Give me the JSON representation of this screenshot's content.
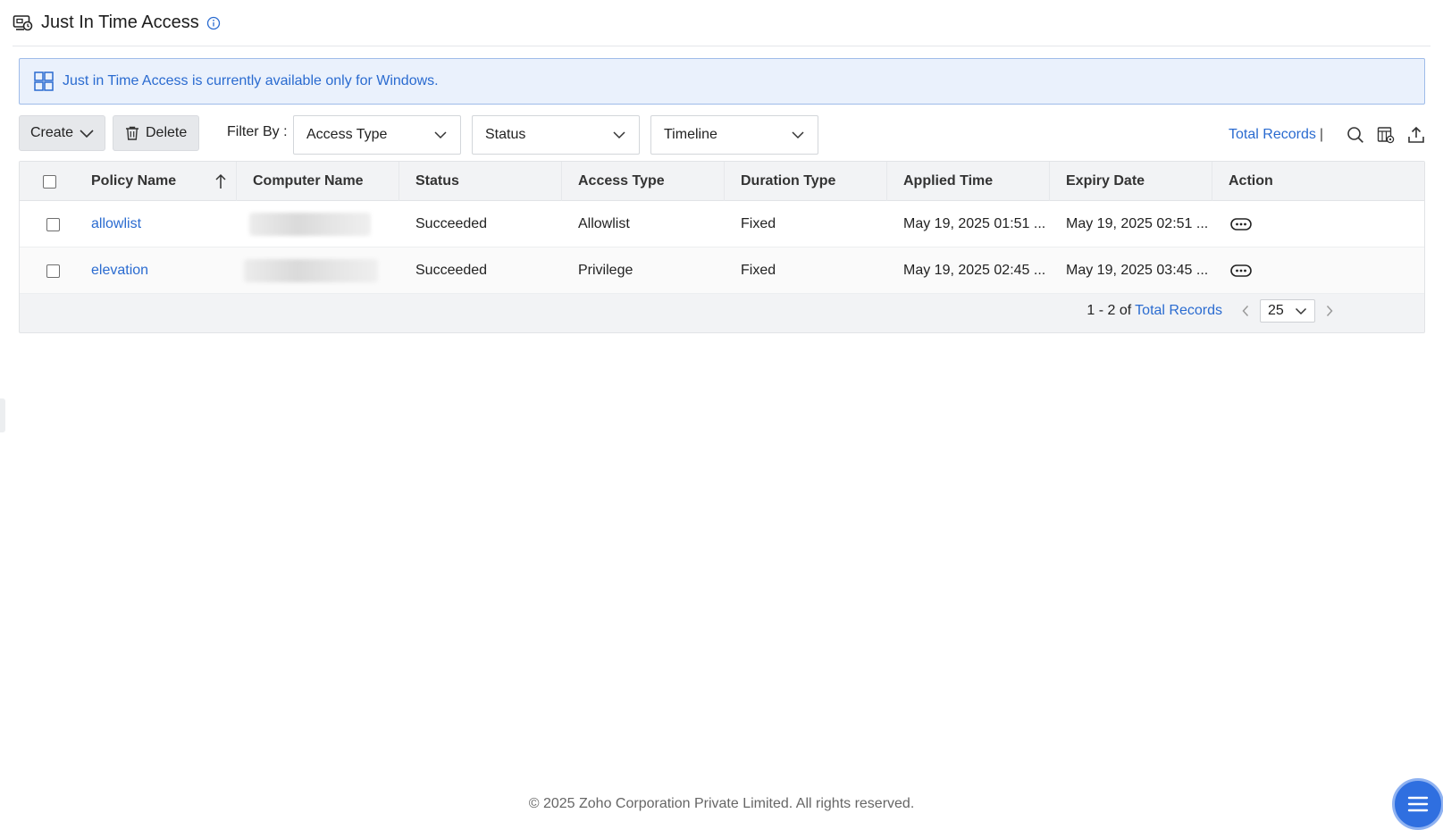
{
  "header": {
    "title": "Just In Time Access"
  },
  "banner": {
    "text": "Just in Time Access is currently available only for Windows."
  },
  "toolbar": {
    "create_label": "Create",
    "delete_label": "Delete",
    "filter_label": "Filter By :",
    "filters": [
      "Access Type",
      "Status",
      "Timeline"
    ],
    "total_records_label": "Total Records",
    "separator": "|"
  },
  "table": {
    "columns": [
      "Policy Name",
      "Computer Name",
      "Status",
      "Access Type",
      "Duration Type",
      "Applied Time",
      "Expiry Date",
      "Action"
    ],
    "rows": [
      {
        "policy_name": "allowlist",
        "computer_name": "",
        "status": "Succeeded",
        "access_type": "Allowlist",
        "duration_type": "Fixed",
        "applied_time": "May 19, 2025 01:51 ...",
        "expiry_date": "May 19, 2025 02:51 ..."
      },
      {
        "policy_name": "elevation",
        "computer_name": "",
        "status": "Succeeded",
        "access_type": "Privilege",
        "duration_type": "Fixed",
        "applied_time": "May 19, 2025 02:45 ...",
        "expiry_date": "May 19, 2025 03:45 ..."
      }
    ]
  },
  "pagination": {
    "range": "1 - 2 of",
    "total_label": "Total Records",
    "page_size": "25"
  },
  "footer": {
    "copyright": "© 2025 Zoho Corporation Private Limited. All rights reserved."
  },
  "colors": {
    "accent": "#2a6bd0",
    "banner_bg": "#eaf1fc",
    "fab": "#2f6fe0"
  },
  "icons": [
    "jit-access-icon",
    "info-icon",
    "windows-icon",
    "chevron-down-icon",
    "trash-icon",
    "search-icon",
    "column-settings-icon",
    "export-icon",
    "sort-up-icon",
    "more-actions-icon",
    "chevron-left-icon",
    "chevron-right-icon",
    "menu-icon"
  ]
}
